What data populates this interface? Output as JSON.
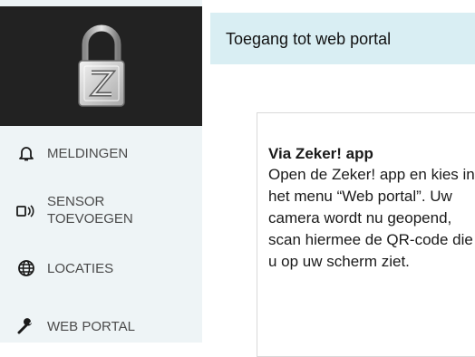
{
  "sidebar": {
    "logo_icon": "padlock-z-icon",
    "items": [
      {
        "label": "MELDINGEN",
        "icon": "bell-icon"
      },
      {
        "label": "SENSOR\nTOEVOEGEN",
        "icon": "sensor-icon"
      },
      {
        "label": "LOCATIES",
        "icon": "globe-icon"
      },
      {
        "label": "WEB PORTAL",
        "icon": "wrench-icon"
      }
    ]
  },
  "header": {
    "title": "Toegang tot web portal"
  },
  "card": {
    "title": "Via Zeker! app",
    "text": "Open de Zeker! app en kies in het menu “Web portal”. Uw camera wordt nu geopend, scan hiermee de QR-code die u op uw scherm ziet."
  },
  "colors": {
    "sidebar_bg": "#eef4f6",
    "logo_bg": "#222222",
    "header_bg": "#d9eef3",
    "nav_text": "#4a4a4a"
  }
}
